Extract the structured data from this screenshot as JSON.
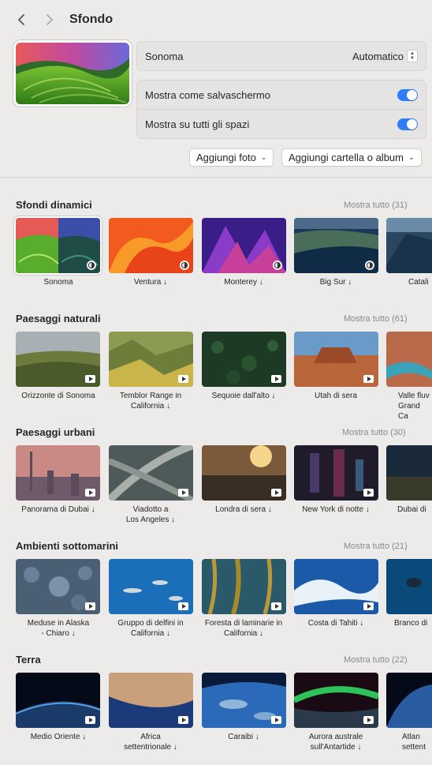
{
  "header": {
    "title": "Sfondo"
  },
  "current": {
    "wallpaper_name": "Sonoma",
    "mode": "Automatico",
    "screensaver_label": "Mostra come salvaschermo",
    "all_spaces_label": "Mostra su tutti gli spazi",
    "screensaver_on": true,
    "all_spaces_on": true
  },
  "buttons": {
    "add_photo": "Aggiungi foto",
    "add_folder": "Aggiungi cartella o album"
  },
  "sections": [
    {
      "title": "Sfondi dinamici",
      "show_all": "Mostra tutto (31)",
      "items": [
        {
          "caption": "Sonoma",
          "badge": "dynamic"
        },
        {
          "caption": "Ventura ↓",
          "badge": "dynamic"
        },
        {
          "caption": "Monterey ↓",
          "badge": "dynamic"
        },
        {
          "caption": "Big Sur ↓",
          "badge": "dynamic"
        },
        {
          "caption": "Catali",
          "badge": ""
        }
      ]
    },
    {
      "title": "Paesaggi naturali",
      "show_all": "Mostra tutto (61)",
      "items": [
        {
          "caption": "Orizzonte di Sonoma",
          "badge": "play"
        },
        {
          "caption": "Temblor Range in\nCalifornia ↓",
          "badge": "play"
        },
        {
          "caption": "Sequoie dall'alto ↓",
          "badge": "play"
        },
        {
          "caption": "Utah di sera",
          "badge": "play"
        },
        {
          "caption": "Valle fluv\nGrand Ca",
          "badge": ""
        }
      ]
    },
    {
      "title": "Paesaggi urbani",
      "show_all": "Mostra tutto (30)",
      "items": [
        {
          "caption": "Panorama di Dubai ↓",
          "badge": "play"
        },
        {
          "caption": "Viadotto a\nLos Angeles ↓",
          "badge": "play"
        },
        {
          "caption": "Londra di sera ↓",
          "badge": "play"
        },
        {
          "caption": "New York di notte ↓",
          "badge": "play"
        },
        {
          "caption": "Dubai di",
          "badge": ""
        }
      ]
    },
    {
      "title": "Ambienti sottomarini",
      "show_all": "Mostra tutto (21)",
      "items": [
        {
          "caption": "Meduse in Alaska\n- Chiaro ↓",
          "badge": "play"
        },
        {
          "caption": "Gruppo di delfini in\nCalifornia ↓",
          "badge": "play"
        },
        {
          "caption": "Foresta di laminarie in\nCalifornia ↓",
          "badge": "play"
        },
        {
          "caption": "Costa di Tahiti ↓",
          "badge": "play"
        },
        {
          "caption": "Branco di",
          "badge": ""
        }
      ]
    },
    {
      "title": "Terra",
      "show_all": "Mostra tutto (22)",
      "items": [
        {
          "caption": "Medio Oriente ↓",
          "badge": "play"
        },
        {
          "caption": "Africa\nsettentrionale ↓",
          "badge": "play"
        },
        {
          "caption": "Caraibi ↓",
          "badge": "play"
        },
        {
          "caption": "Aurora australe\nsull'Antartide ↓",
          "badge": "play"
        },
        {
          "caption": "Atlan\nsettent",
          "badge": ""
        }
      ]
    }
  ]
}
